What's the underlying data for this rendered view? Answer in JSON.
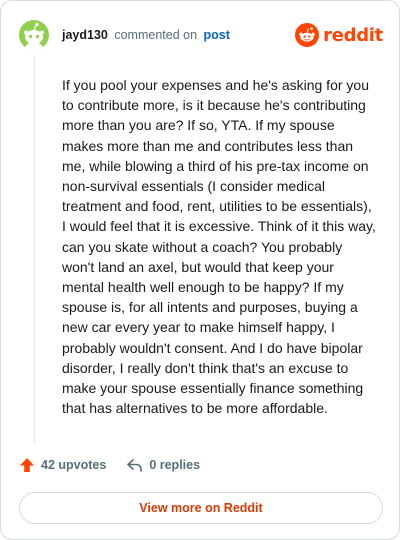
{
  "header": {
    "username": "jayd130",
    "verb": "commented on",
    "post_link": "post",
    "logo_text": "reddit"
  },
  "comment": {
    "text": "If you pool your expenses and he's asking for you to contribute more, is it because he's contributing more than you are? If so, YTA. If my spouse makes more than me and contributes less than me, while blowing a third of his pre-tax income on non-survival essentials (I consider medical treatment and food, rent, utilities to be essentials), I would feel that it is excessive. Think of it this way, can you skate without a coach? You probably won't land an axel, but would that keep your mental health well enough to be happy? If my spouse is, for all intents and purposes, buying a new car every year to make himself happy, I probably wouldn't consent. And I do have bipolar disorder, I really don't think that's an excuse to make your spouse essentially finance something that has alternatives to be more affordable."
  },
  "actions": {
    "upvotes_label": "42 upvotes",
    "replies_label": "0 replies"
  },
  "footer": {
    "view_more_label": "View more on Reddit"
  },
  "colors": {
    "brand": "#ff4500",
    "link": "#0a63c5",
    "avatar_bg": "#8fd14f",
    "muted": "#576f76",
    "border": "#d9dcdf"
  },
  "icons": {
    "upvote": "upvote-arrow-icon",
    "reply": "reply-arrow-icon",
    "logo": "reddit-snoo-icon",
    "avatar": "snoo-avatar-icon"
  }
}
